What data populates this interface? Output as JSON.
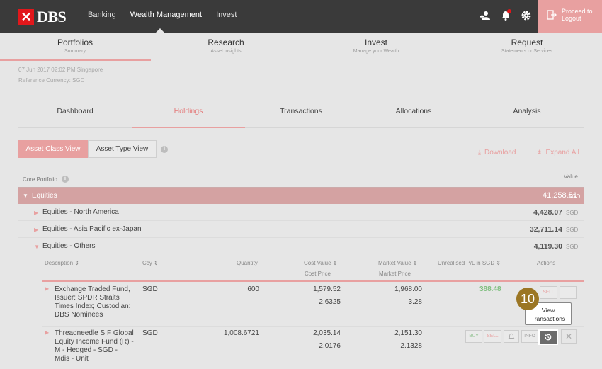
{
  "header": {
    "logo_text": "DBS",
    "nav": [
      "Banking",
      "Wealth Management",
      "Invest"
    ],
    "logout_line1": "Proceed to",
    "logout_line2": "Logout",
    "icons": [
      "user-add-icon",
      "bell-icon",
      "gear-icon",
      "logout-icon"
    ]
  },
  "subnav": [
    {
      "title": "Portfolios",
      "sub": "Summary"
    },
    {
      "title": "Research",
      "sub": "Asset insights"
    },
    {
      "title": "Invest",
      "sub": "Manage your Wealth"
    },
    {
      "title": "Request",
      "sub": "Statements or Services"
    }
  ],
  "meta": {
    "timestamp": "07 Jun 2017 02:02 PM Singapore",
    "currency": "Reference Currency: SGD"
  },
  "tabs": [
    "Dashboard",
    "Holdings",
    "Transactions",
    "Allocations",
    "Analysis"
  ],
  "views": {
    "asset_class": "Asset Class View",
    "asset_type": "Asset Type View"
  },
  "actions": {
    "download": "Download",
    "expand": "Expand All"
  },
  "table": {
    "portfolio_label": "Core Portfolio",
    "value_label": "Value",
    "equities": {
      "label": "Equities",
      "value": "41,258.51",
      "currency": "SGD"
    },
    "groups": [
      {
        "label": "Equities - North America",
        "value": "4,428.07",
        "currency": "SGD"
      },
      {
        "label": "Equities - Asia Pacific ex-Japan",
        "value": "32,711.14",
        "currency": "SGD"
      },
      {
        "label": "Equities - Others",
        "value": "4,119.30",
        "currency": "SGD"
      }
    ],
    "columns": {
      "description": "Description",
      "ccy": "Ccy",
      "quantity": "Quantity",
      "cost_value": "Cost Value",
      "cost_price": "Cost Price",
      "market_value": "Market Value",
      "market_price": "Market Price",
      "pl": "Unrealised P/L in SGD",
      "actions": "Actions"
    },
    "rows": [
      {
        "desc": [
          "Exchange Traded Fund,",
          "Issuer: SPDR Straits",
          "Times Index; Custodian:",
          "DBS Nominees"
        ],
        "ccy": "SGD",
        "qty": "600",
        "cost_value": "1,579.52",
        "cost_price": "2.6325",
        "market_value": "1,968.00",
        "market_price": "3.28",
        "pl": "388.48"
      },
      {
        "desc": [
          "Threadneedle SIF Global",
          "Equity Income Fund (R) -",
          "M - Hedged - SGD -",
          "Mdis - Unit"
        ],
        "ccy": "SGD",
        "qty": "1,008.6721",
        "cost_value": "2,035.14",
        "cost_price": "2.0176",
        "market_value": "2,151.30",
        "market_price": "2.1328"
      }
    ],
    "btn": {
      "buy": "BUY",
      "sell": "SELL",
      "info": "INFO",
      "more": "···"
    }
  },
  "tooltip": {
    "line1": "View",
    "line2": "Transactions"
  },
  "step_number": "10"
}
